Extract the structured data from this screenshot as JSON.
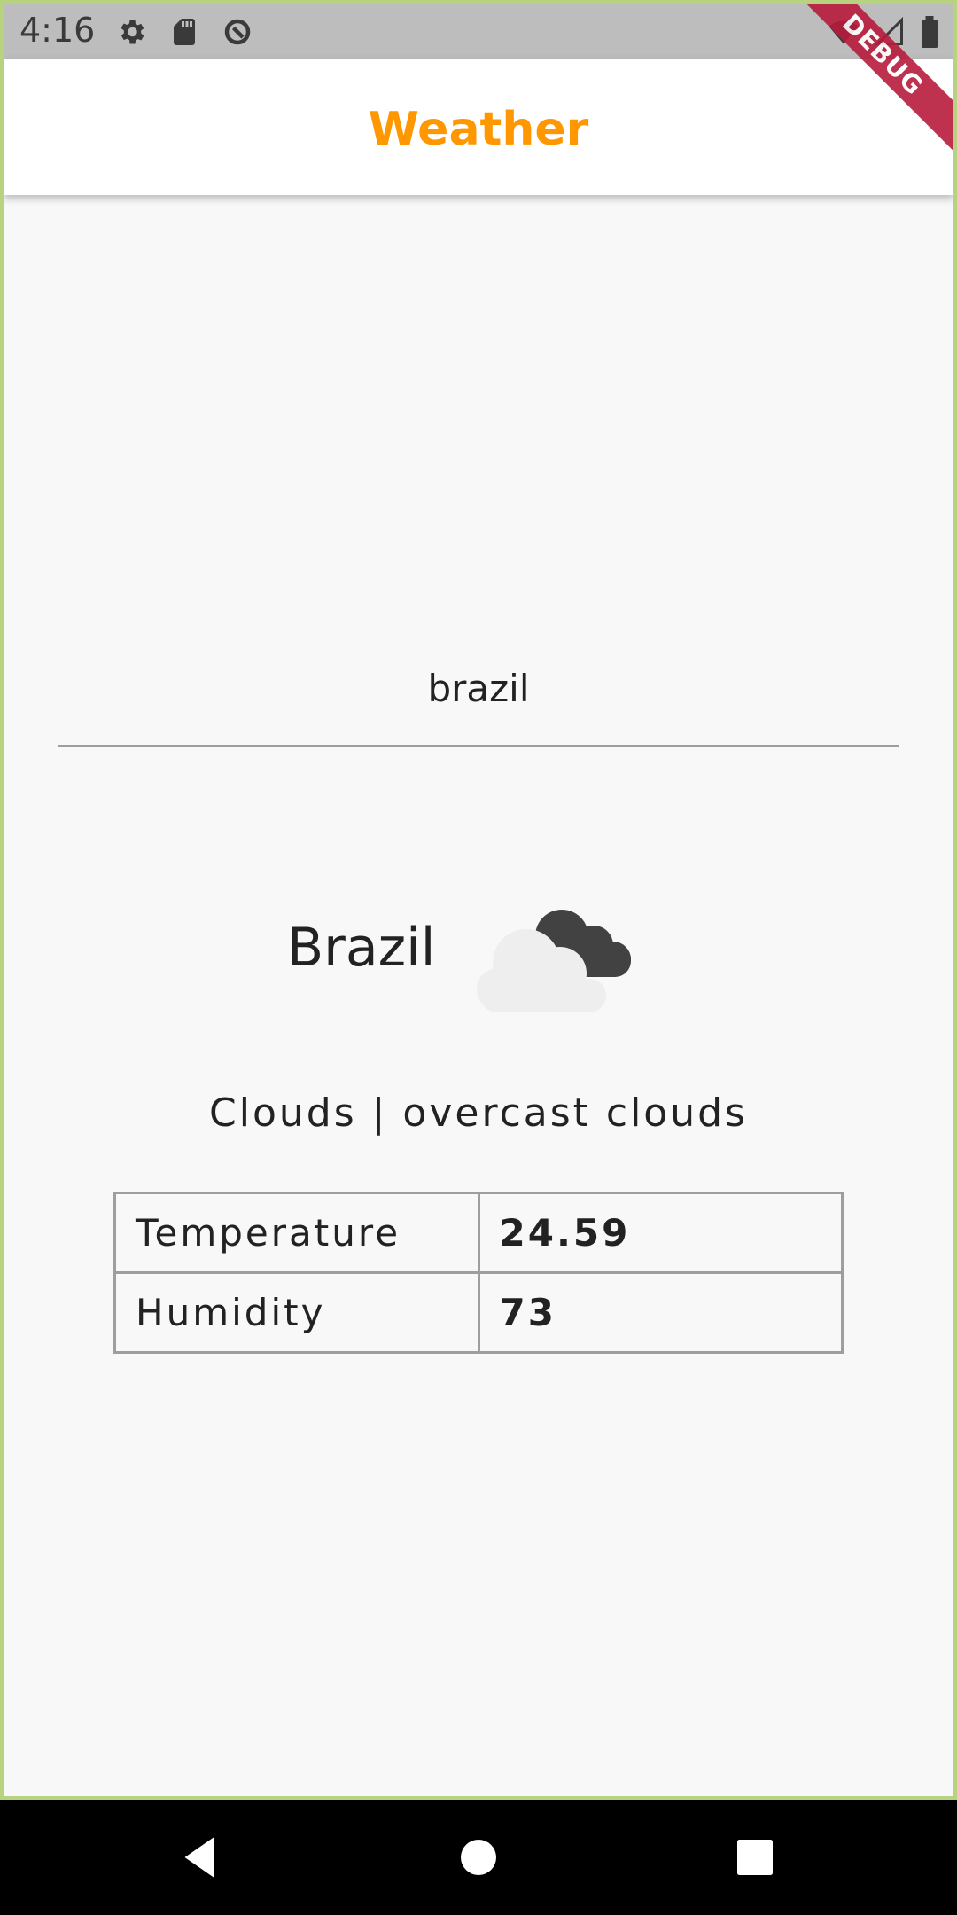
{
  "status_bar": {
    "time": "4:16",
    "icons": [
      "settings-icon",
      "sd-card-icon",
      "sync-icon",
      "wifi-icon",
      "signal-icon",
      "battery-icon"
    ]
  },
  "app_bar": {
    "title": "Weather",
    "title_color": "#ff9800",
    "debug_label": "DEBUG"
  },
  "search": {
    "value": "brazil"
  },
  "weather": {
    "city": "Brazil",
    "icon": "cloudy-icon",
    "condition": "Clouds | overcast clouds",
    "rows": [
      {
        "label": "Temperature",
        "value": "24.59"
      },
      {
        "label": "Humidity",
        "value": "73"
      }
    ]
  },
  "nav_bar": {
    "buttons": [
      "back-icon",
      "home-icon",
      "recents-icon"
    ]
  }
}
